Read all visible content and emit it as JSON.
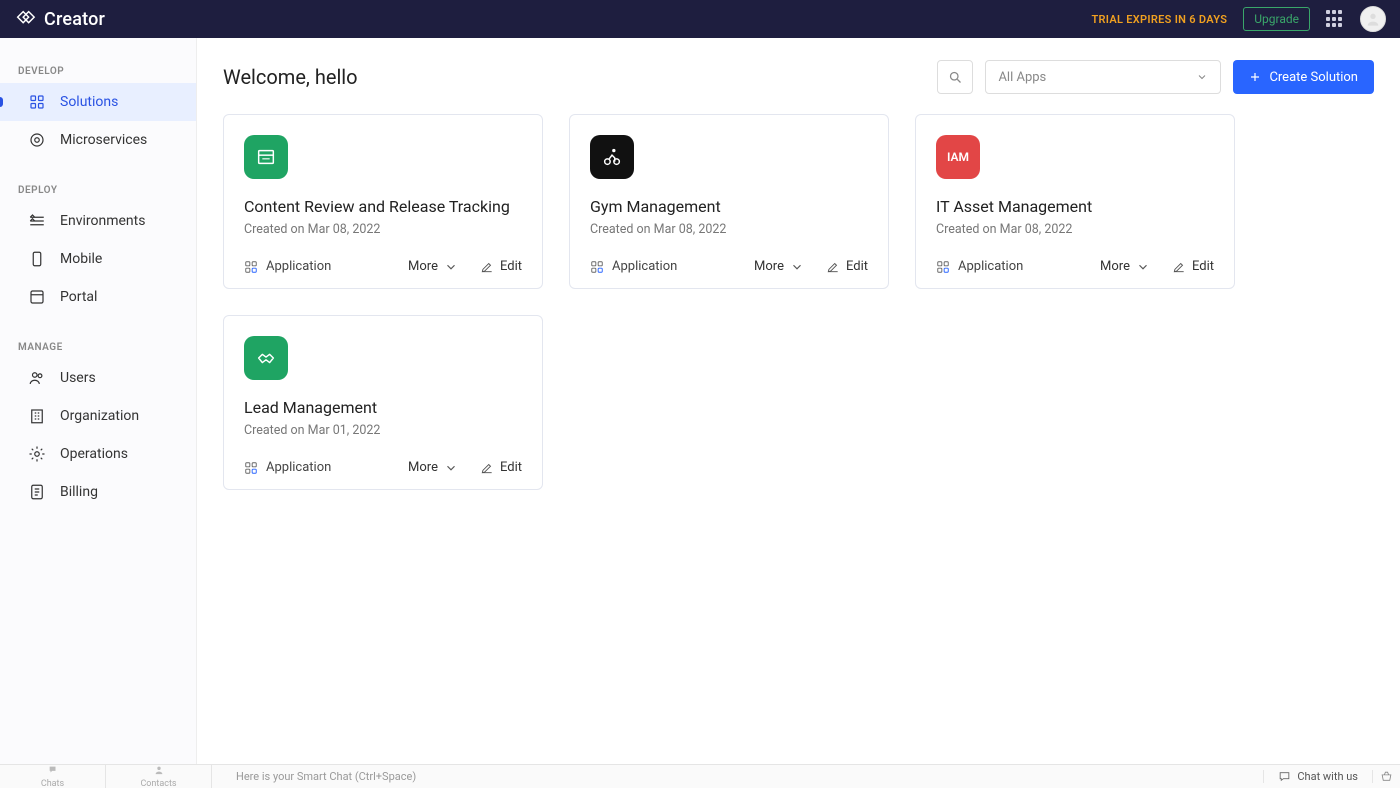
{
  "header": {
    "product_name": "Creator",
    "trial_text": "TRIAL EXPIRES IN 6 DAYS",
    "upgrade_label": "Upgrade"
  },
  "sidebar": {
    "sections": [
      {
        "title": "DEVELOP",
        "items": [
          {
            "id": "solutions",
            "label": "Solutions",
            "active": true
          },
          {
            "id": "microservices",
            "label": "Microservices",
            "active": false
          }
        ]
      },
      {
        "title": "DEPLOY",
        "items": [
          {
            "id": "environments",
            "label": "Environments",
            "active": false
          },
          {
            "id": "mobile",
            "label": "Mobile",
            "active": false
          },
          {
            "id": "portal",
            "label": "Portal",
            "active": false
          }
        ]
      },
      {
        "title": "MANAGE",
        "items": [
          {
            "id": "users",
            "label": "Users",
            "active": false
          },
          {
            "id": "organization",
            "label": "Organization",
            "active": false
          },
          {
            "id": "operations",
            "label": "Operations",
            "active": false
          },
          {
            "id": "billing",
            "label": "Billing",
            "active": false
          }
        ]
      }
    ]
  },
  "main": {
    "welcome": "Welcome, hello",
    "filter_selected": "All Apps",
    "create_label": "Create Solution"
  },
  "cards": [
    {
      "icon_style": "green",
      "icon_kind": "browser",
      "icon_text": "",
      "title": "Content Review and Release Tracking",
      "subtitle": "Created on Mar 08, 2022",
      "type_label": "Application",
      "more_label": "More",
      "edit_label": "Edit"
    },
    {
      "icon_style": "black",
      "icon_kind": "cyclist",
      "icon_text": "",
      "title": "Gym Management",
      "subtitle": "Created on Mar 08, 2022",
      "type_label": "Application",
      "more_label": "More",
      "edit_label": "Edit"
    },
    {
      "icon_style": "red",
      "icon_kind": "text",
      "icon_text": "IAM",
      "title": "IT Asset Management",
      "subtitle": "Created on Mar 08, 2022",
      "type_label": "Application",
      "more_label": "More",
      "edit_label": "Edit"
    },
    {
      "icon_style": "green",
      "icon_kind": "handshake",
      "icon_text": "",
      "title": "Lead Management",
      "subtitle": "Created on Mar 01, 2022",
      "type_label": "Application",
      "more_label": "More",
      "edit_label": "Edit"
    }
  ],
  "bottombar": {
    "tabs": [
      {
        "id": "chats",
        "label": "Chats"
      },
      {
        "id": "contacts",
        "label": "Contacts"
      }
    ],
    "smart_chat_placeholder": "Here is your Smart Chat (Ctrl+Space)",
    "chat_with_us": "Chat with us"
  }
}
